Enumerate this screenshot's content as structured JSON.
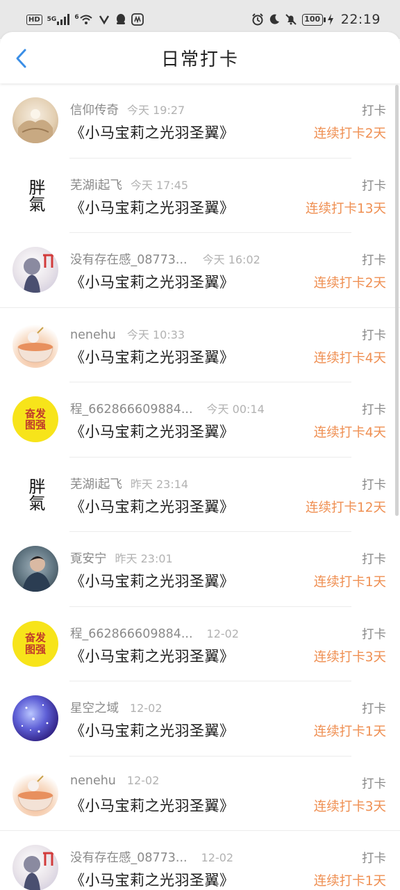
{
  "status_bar": {
    "hd": "HD",
    "network": "5G",
    "wifi_sub": "6",
    "battery": "100",
    "time": "22:19"
  },
  "header": {
    "title": "日常打卡"
  },
  "entries": [
    {
      "name": "信仰传奇",
      "time": "今天 19:27",
      "book": "《小马宝莉之光羽圣翼》",
      "action": "打卡",
      "streak": "连续打卡2天"
    },
    {
      "name": "芜湖i起飞",
      "time": "今天 17:45",
      "book": "《小马宝莉之光羽圣翼》",
      "action": "打卡",
      "streak": "连续打卡13天"
    },
    {
      "name": "没有存在感_08773...",
      "time": "今天 16:02",
      "book": "《小马宝莉之光羽圣翼》",
      "action": "打卡",
      "streak": "连续打卡2天"
    },
    {
      "name": "nenehu",
      "time": "今天 10:33",
      "book": "《小马宝莉之光羽圣翼》",
      "action": "打卡",
      "streak": "连续打卡4天"
    },
    {
      "name": "程_662866609884...",
      "time": "今天 00:14",
      "book": "《小马宝莉之光羽圣翼》",
      "action": "打卡",
      "streak": "连续打卡4天"
    },
    {
      "name": "芜湖i起飞",
      "time": "昨天 23:14",
      "book": "《小马宝莉之光羽圣翼》",
      "action": "打卡",
      "streak": "连续打卡12天"
    },
    {
      "name": "覔安宁",
      "time": "昨天 23:01",
      "book": "《小马宝莉之光羽圣翼》",
      "action": "打卡",
      "streak": "连续打卡1天"
    },
    {
      "name": "程_662866609884...",
      "time": "12-02",
      "book": "《小马宝莉之光羽圣翼》",
      "action": "打卡",
      "streak": "连续打卡3天"
    },
    {
      "name": "星空之域",
      "time": "12-02",
      "book": "《小马宝莉之光羽圣翼》",
      "action": "打卡",
      "streak": "连续打卡1天"
    },
    {
      "name": "nenehu",
      "time": "12-02",
      "book": "《小马宝莉之光羽圣翼》",
      "action": "打卡",
      "streak": "连续打卡3天"
    },
    {
      "name": "没有存在感_08773...",
      "time": "12-02",
      "book": "《小马宝莉之光羽圣翼》",
      "action": "打卡",
      "streak": "连续打卡1天"
    }
  ],
  "avatar_art": {
    "calligraphy": "胖氣",
    "yellow_seal": "奋发图强"
  },
  "colors": {
    "accent_streak": "#ef8f52",
    "back_arrow": "#3a8ee6",
    "status_bar_bg": "#e8e8e8"
  }
}
